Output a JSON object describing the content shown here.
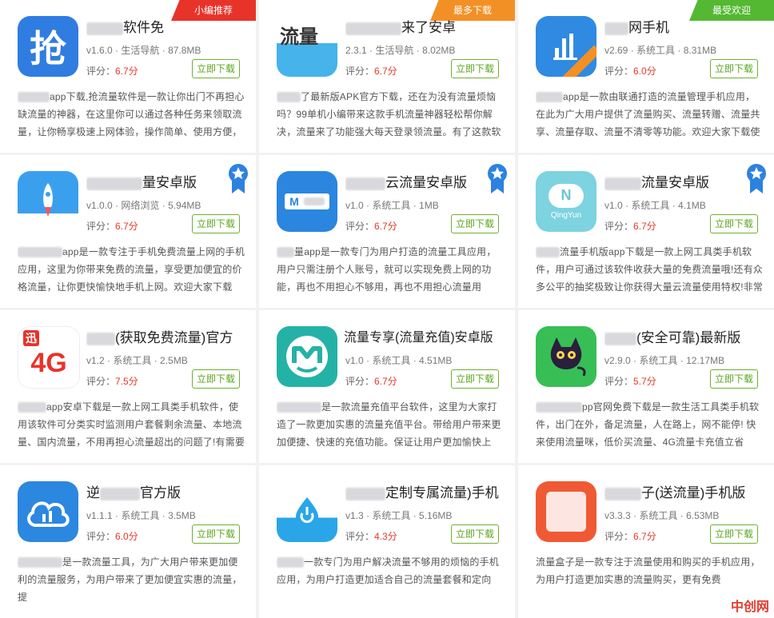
{
  "cards": [
    {
      "title_suffix": "软件免",
      "version": "v1.6.0",
      "category": "生活导航",
      "size": "87.8MB",
      "score_label": "评分：",
      "score": "6.7分",
      "download_label": "立即下载",
      "desc_lead": "app下载,抢流量软件是一款让你出门不再担心缺流量的神器，在这里你可以通过各种任务来领取流量，让你畅享极速上网体验，操作简单、使用方便，",
      "ribbon": "小编推荐",
      "ribbon_color": "#e8332a",
      "icon": "grab-icon",
      "icon_text": "抢"
    },
    {
      "title_suffix": "来了安卓",
      "version": "2.3.1",
      "category": "生活导航",
      "size": "8.02MB",
      "score_label": "评分：",
      "score": "6.7分",
      "download_label": "立即下载",
      "desc_lead": "了最新版APK官方下载，还在为没有流量烦恼吗？99单机小编带来这款手机流量神器轻松帮你解决，流量来了功能强大每天登录领流量。有了这款软",
      "ribbon": "最多下载",
      "ribbon_color": "#f39025",
      "icon": "traffic-icon",
      "icon_text": "流量"
    },
    {
      "title_suffix": "网手机",
      "version": "v2.69",
      "category": "系统工具",
      "size": "8.31MB",
      "score_label": "评分：",
      "score": "6.0分",
      "download_label": "立即下载",
      "desc_lead": "app是一款由联通打造的流量管理手机应用，在此为广大用户提供了流量购买、流量转赠、流量共享、流量存取、流量不清零等功能。欢迎大家下载使",
      "ribbon": "最受欢迎",
      "ribbon_color": "#54b832",
      "icon": "signal-bars-icon",
      "icon_text": ""
    },
    {
      "title_suffix": "量安卓版",
      "version": "v1.0.0",
      "category": "网络浏览",
      "size": "5.94MB",
      "score_label": "评分：",
      "score": "6.7分",
      "download_label": "立即下载",
      "desc_lead": "app是一款专注于手机免费流量上网的手机应用，这里为你带来免费的流量，享受更加便宜的价格流量，让你更快愉快地手机上网。欢迎大家下载",
      "ribbon": "",
      "icon": "rocket-icon",
      "icon_text": ""
    },
    {
      "title_suffix": "云流量安卓版",
      "version": "v1.0",
      "category": "系统工具",
      "size": "1MB",
      "score_label": "评分：",
      "score": "6.7分",
      "download_label": "立即下载",
      "desc_lead": "量app是一款专门为用户打造的流量工具应用，用户只需注册个人账号，就可以实现免费上网的功能，再也不用担心不够用，再也不用担心流量用",
      "ribbon": "",
      "icon": "m-card-icon",
      "icon_text": "M"
    },
    {
      "title_suffix": "流量安卓版",
      "version": "v1.0",
      "category": "系统工具",
      "size": "4.1MB",
      "score_label": "评分：",
      "score": "6.7分",
      "download_label": "立即下载",
      "desc_lead": "流量手机版app下载是一款上网工具类手机软件，用户可通过该软件收获大量的免费流量哦!还有众多公平的抽奖极致让你获得大量云流量使用特权!非常",
      "ribbon": "",
      "icon": "qingyun-icon",
      "icon_text": "QingYun"
    },
    {
      "title_suffix": "(获取免费流量)官方",
      "version": "v1.2",
      "category": "系统工具",
      "size": "2.5MB",
      "score_label": "评分：",
      "score": "7.5分",
      "download_label": "立即下载",
      "desc_lead": "app安卓下载是一款上网工具类手机软件，使用该软件可分类实时监测用户套餐剩余流量、本地流量、国内流量，不用再担心流量超出的问题了!有需要",
      "ribbon": "",
      "icon": "4g-icon",
      "icon_text": "4G"
    },
    {
      "title_suffix": "流量专享(流量充值)安卓版",
      "version": "v1.0",
      "category": "系统工具",
      "size": "4.51MB",
      "score_label": "评分：",
      "score": "6.7分",
      "download_label": "立即下载",
      "desc_lead": "是一款流量充值平台软件，这里为大家打造了一款更加实惠的流量充值平台。带给用户带来更加便捷、快速的充值功能。保证让用户更加愉快上",
      "ribbon": "",
      "icon": "smile-m-icon",
      "icon_text": ""
    },
    {
      "title_suffix": "(安全可靠)最新版",
      "version": "v2.9.0",
      "category": "系统工具",
      "size": "12.17MB",
      "score_label": "评分：",
      "score": "5.7分",
      "download_label": "立即下载",
      "desc_lead": "pp官网免费下载是一款生活工具类手机软件，出门在外，备足流量，人在路上，网不能停! 快来使用流量咪，低价买流量、4G流量卡充值立省",
      "ribbon": "",
      "icon": "cat-icon",
      "icon_text": ""
    },
    {
      "title_suffix": "官方版",
      "version": "v1.1.1",
      "category": "系统工具",
      "size": "3.5MB",
      "score_label": "评分：",
      "score": "6.0分",
      "download_label": "立即下载",
      "desc_lead": "是一款流量工具，为广大用户带来更加便利的流量服务，为用户带来了更加便宜实惠的流量，提",
      "ribbon": "",
      "icon": "cloud-icon",
      "icon_text": ""
    },
    {
      "title_suffix": "定制专属流量)手机",
      "version": "v1.3",
      "category": "系统工具",
      "size": "5.16MB",
      "score_label": "评分：",
      "score": "4.3分",
      "download_label": "立即下载",
      "desc_lead": "一款专门为用户解决流量不够用的烦恼的手机应用，为用户打造更加适合自己的流量套餐和定向",
      "ribbon": "",
      "icon": "power-drop-icon",
      "icon_text": ""
    },
    {
      "title_suffix": "子(送流量)手机版",
      "version": "v3.3.3",
      "category": "系统工具",
      "size": "6.53MB",
      "score_label": "评分：",
      "score": "6.7分",
      "download_label": "立即下载",
      "desc_lead": "流量盒子是一款专注于流量使用和购买的手机应用，为用户打造更加实惠的流量购买，更有免费",
      "ribbon": "",
      "icon": "box-icon",
      "icon_text": ""
    }
  ],
  "watermark": "中创网"
}
